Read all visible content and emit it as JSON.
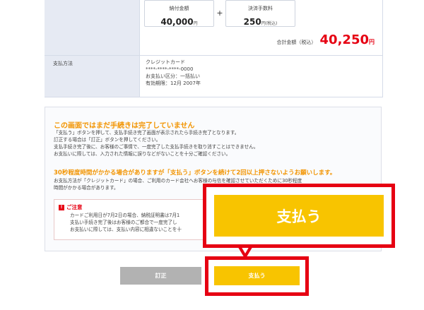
{
  "payment": {
    "amount_label": "納付金額",
    "amount_value": "40,000",
    "amount_unit": "円",
    "plus_sign": "+",
    "fee_label": "決済手数料",
    "fee_value": "250",
    "fee_unit": "円(税込)",
    "total_label": "合計金額（税込）",
    "total_value": "40,250",
    "total_unit": "円",
    "method_label": "支払方法",
    "method_name": "クレジットカード",
    "card_number": "****-****-****-0000",
    "installment": "お支払い区分：一括払い",
    "expiry": "有効期限：12月 2007年"
  },
  "notice": {
    "heading": "この画面ではまだ手続きは完了していません",
    "lines": [
      "「支払う」ボタンを押して、支払手続き完了画面が表示されたら手続き完了となります。",
      "訂正する場合は「訂正」ボタンを押してください。",
      "支払手続き完了後に、お客様のご事情で、一度完了した支払手続きを取り消すことはできません。",
      "お支払いに際しては、入力された情報に誤りなどがないことを十分ご確認ください。"
    ],
    "subheading": "30秒程度時間がかかる場合がありますが「支払う」ボタンを続けて2回以上押さないようお願いします。",
    "sub_lines": [
      "お支払方法が「クレジットカード」の場合、ご利用のカード会社へお客様の与信を確認させていただくために30秒程度",
      "時間がかかる場合があります。"
    ],
    "caution_title": "ご注意",
    "caution_lines": [
      "カードご利用日が7月2日の場合、納税証明書は7月1",
      "支払い手続き完了後はお客様のご都合で一度完了し",
      "お支払いに際しては、支払い内容に相違ないことを十"
    ]
  },
  "buttons": {
    "correct_label": "訂正",
    "pay_label": "支払う",
    "pay_zoom_label": "支払う"
  },
  "colors": {
    "highlight_red": "#e60012",
    "pay_yellow": "#f8c400",
    "notice_orange": "#f29400",
    "total_red": "#e60012"
  }
}
